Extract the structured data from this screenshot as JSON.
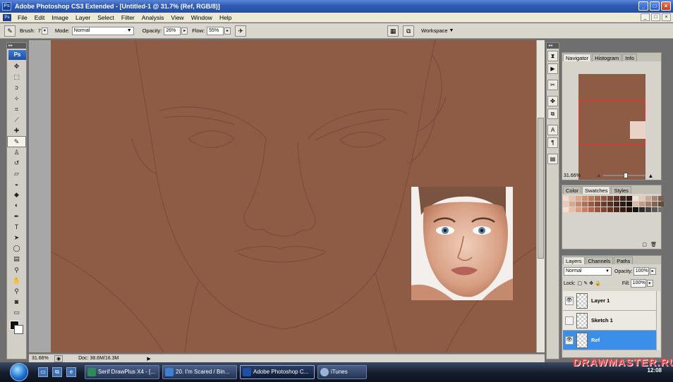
{
  "window": {
    "title": "Adobe Photoshop CS3 Extended - [Untitled-1 @ 31.7% (Ref, RGB/8)]",
    "app_badge": "Ps",
    "controls": [
      "_",
      "□",
      "×"
    ]
  },
  "menubar": {
    "items": [
      "File",
      "Edit",
      "Image",
      "Layer",
      "Select",
      "Filter",
      "Analysis",
      "View",
      "Window",
      "Help"
    ]
  },
  "options": {
    "brush_label": "Brush:",
    "brush_size": "7",
    "mode_label": "Mode:",
    "mode_value": "Normal",
    "opacity_label": "Opacity:",
    "opacity_value": "26%",
    "flow_label": "Flow:",
    "flow_value": "55%",
    "workspace_label": "Workspace"
  },
  "toolbox": {
    "badge": "Ps",
    "tools": [
      {
        "name": "move-tool",
        "glyph": "✥"
      },
      {
        "name": "marquee-tool",
        "glyph": "⬚"
      },
      {
        "name": "lasso-tool",
        "glyph": "ↄ"
      },
      {
        "name": "magic-wand-tool",
        "glyph": "✧"
      },
      {
        "name": "crop-tool",
        "glyph": "⌗"
      },
      {
        "name": "slice-tool",
        "glyph": "⟋"
      },
      {
        "name": "healing-brush-tool",
        "glyph": "✚"
      },
      {
        "name": "brush-tool",
        "glyph": "✎"
      },
      {
        "name": "clone-stamp-tool",
        "glyph": "♙"
      },
      {
        "name": "history-brush-tool",
        "glyph": "↺"
      },
      {
        "name": "eraser-tool",
        "glyph": "▱"
      },
      {
        "name": "paint-bucket-tool",
        "glyph": "◒"
      },
      {
        "name": "blur-tool",
        "glyph": "◆"
      },
      {
        "name": "dodge-tool",
        "glyph": "◐"
      },
      {
        "name": "pen-tool",
        "glyph": "✒"
      },
      {
        "name": "type-tool",
        "glyph": "T"
      },
      {
        "name": "path-selection-tool",
        "glyph": "➤"
      },
      {
        "name": "shape-tool",
        "glyph": "◯"
      },
      {
        "name": "notes-tool",
        "glyph": "▤"
      },
      {
        "name": "eyedropper-tool",
        "glyph": "⚲"
      },
      {
        "name": "hand-tool",
        "glyph": "✋"
      },
      {
        "name": "zoom-tool",
        "glyph": "⚲"
      },
      {
        "name": "quick-mask-tool",
        "glyph": "◙"
      },
      {
        "name": "screen-mode-tool",
        "glyph": "▭"
      }
    ],
    "active_tool": "brush-tool"
  },
  "status": {
    "zoom": "31.66%",
    "doc": "Doc: 38.6M/16.3M"
  },
  "navigator": {
    "tabs": [
      "Navigator",
      "Histogram",
      "Info"
    ],
    "zoom": "31.66%",
    "zoom_slider_fraction": 0.55
  },
  "swatches": {
    "tabs": [
      "Color",
      "Swatches",
      "Styles"
    ],
    "colors": [
      "#f2d9cc",
      "#e8c1ad",
      "#dba88f",
      "#cf9070",
      "#c07a59",
      "#a8664a",
      "#8e5540",
      "#754436",
      "#5c352b",
      "#452822",
      "#301c18",
      "#f4e3da",
      "#e3cbbd",
      "#c9aa98",
      "#a88874",
      "#7c6252",
      "#ecc8b8",
      "#d8a890",
      "#c48a6f",
      "#b07055",
      "#985a44",
      "#804a38",
      "#6a3c2e",
      "#553026",
      "#40241d",
      "#2d1915",
      "#1e100d",
      "#dcbba6",
      "#c29c85",
      "#a37f69",
      "#84644f",
      "#634b3b",
      "#f6dccf",
      "#eabba5",
      "#dc9c80",
      "#c97f61",
      "#b2684c",
      "#98553d",
      "#7f4432",
      "#663528",
      "#4e281f",
      "#381c16",
      "#23110d",
      "#141414",
      "#2a2a2a",
      "#404040",
      "#595959",
      "#737373"
    ]
  },
  "layers": {
    "tabs": [
      "Layers",
      "Channels",
      "Paths"
    ],
    "blend_mode": "Normal",
    "opacity_label": "Opacity:",
    "opacity_value": "100%",
    "lock_label": "Lock:",
    "fill_label": "Fill:",
    "fill_value": "100%",
    "items": [
      {
        "name": "Layer 1",
        "visible": true,
        "selected": false
      },
      {
        "name": "Sketch 1",
        "visible": false,
        "selected": false
      },
      {
        "name": "Ref",
        "visible": true,
        "selected": true
      }
    ]
  },
  "taskbar": {
    "tasks": [
      {
        "label": "Serif DrawPlus X4 - [...",
        "active": false,
        "color": "#2e8b57"
      },
      {
        "label": "20. I'm Scared / Bin...",
        "active": false,
        "color": "#3f7fd0"
      },
      {
        "label": "Adobe Photoshop C...",
        "active": true,
        "color": "#1e4fa6"
      },
      {
        "label": "iTunes",
        "active": false,
        "color": "#9ab4d8"
      }
    ],
    "clock": "12:08"
  },
  "watermark": "DRAWMASTER.RU",
  "colors": {
    "canvas": "#8e5b44",
    "selection": "#3c8fe8"
  }
}
